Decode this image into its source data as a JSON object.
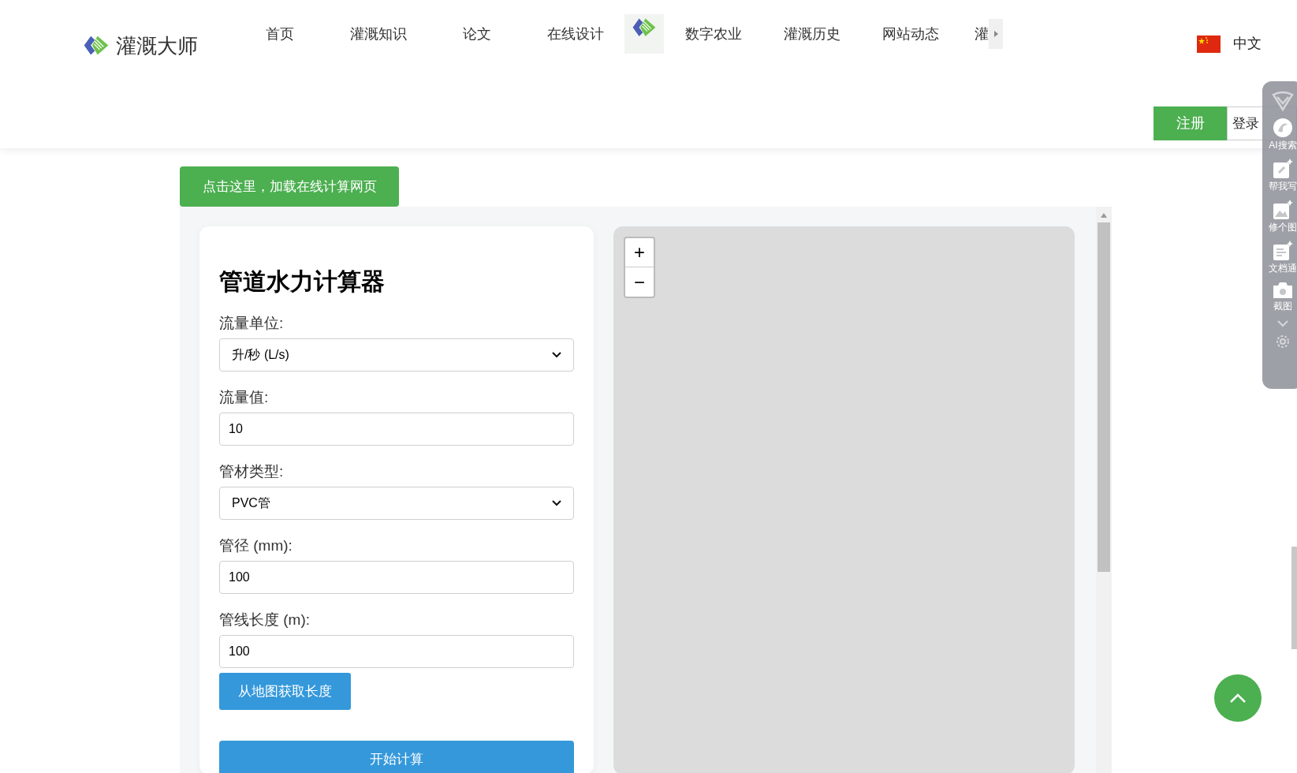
{
  "logo": {
    "text": "灌溉大师"
  },
  "nav": {
    "items": [
      {
        "kind": "link",
        "label": "首页"
      },
      {
        "kind": "link",
        "label": "灌溉知识"
      },
      {
        "kind": "link",
        "label": "论文"
      },
      {
        "kind": "link",
        "label": "在线设计"
      },
      {
        "kind": "image"
      },
      {
        "kind": "link",
        "label": "数字农业"
      },
      {
        "kind": "link",
        "label": "灌溉历史"
      },
      {
        "kind": "link",
        "label": "网站动态"
      },
      {
        "kind": "link",
        "label": "灌"
      }
    ]
  },
  "language": {
    "label": "中文"
  },
  "auth_buttons": [
    {
      "kind": "primary",
      "label": "注册"
    },
    {
      "kind": "secondary",
      "label": "登录"
    }
  ],
  "side_toolbar": {
    "items": [
      {
        "kind": "shield"
      },
      {
        "kind": "ai",
        "label": "AI搜索"
      },
      {
        "kind": "write",
        "label": "帮我写"
      },
      {
        "kind": "image",
        "label": "修个图"
      },
      {
        "kind": "doc",
        "label": "文档通"
      },
      {
        "kind": "camera",
        "label": "截图"
      },
      {
        "kind": "more"
      },
      {
        "kind": "settings"
      }
    ]
  },
  "load_button": {
    "label": "点击这里，加载在线计算网页"
  },
  "calculator": {
    "title": "管道水力计算器",
    "fields": [
      {
        "kind": "select",
        "label": "流量单位:",
        "value": "升/秒 (L/s)"
      },
      {
        "kind": "input",
        "label": "流量值:",
        "value": "10"
      },
      {
        "kind": "select",
        "label": "管材类型:",
        "value": "PVC管"
      },
      {
        "kind": "input",
        "label": "管径 (mm):",
        "value": "100"
      },
      {
        "kind": "input",
        "label": "管线长度 (m):",
        "value": "100"
      }
    ],
    "map_length_button": {
      "label": "从地图获取长度"
    },
    "submit_button": {
      "label": "开始计算"
    }
  },
  "map": {
    "zoom_in": "+",
    "zoom_out": "−"
  }
}
